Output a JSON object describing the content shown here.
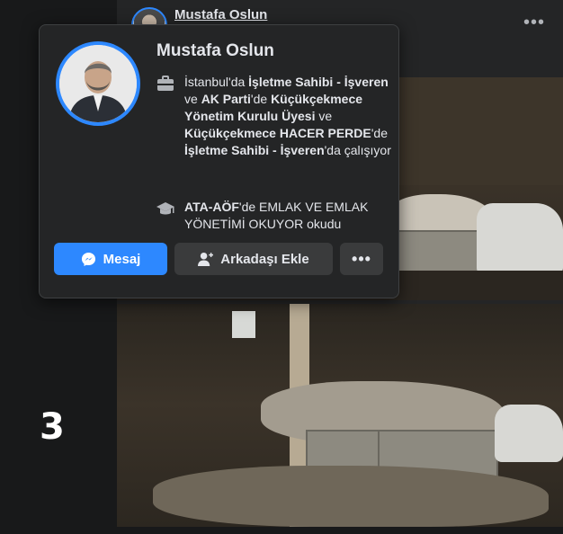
{
  "post": {
    "author_name": "Mustafa Oslun",
    "more_label": "•••"
  },
  "side": {
    "step_number": "3"
  },
  "hover_card": {
    "name": "Mustafa Oslun",
    "work": {
      "p1": "İstanbul'da ",
      "b1": "İşletme Sahibi - İşveren",
      "p2": " ve ",
      "b2": "AK Parti",
      "p3": "'de ",
      "b3": "Küçükçekmece Yönetim Kurulu Üyesi",
      "p4": " ve ",
      "b4": "Küçükçekmece HACER PERDE",
      "p5": "'de ",
      "b5": "İşletme Sahibi - İşveren",
      "p6": "'da çalışıyor"
    },
    "education": {
      "b1": "ATA-AÖF",
      "p1": "'de EMLAK VE EMLAK YÖNETİMİ OKUYOR okudu"
    },
    "buttons": {
      "message": "Mesaj",
      "add_friend": "Arkadaşı Ekle",
      "more": "•••"
    }
  },
  "colors": {
    "primary": "#2d88ff",
    "card_bg": "#242526",
    "page_bg": "#18191a",
    "secondary_button": "#3a3b3c"
  },
  "icons": {
    "work": "briefcase-icon",
    "education": "graduation-cap-icon",
    "message": "messenger-icon",
    "add_friend": "add-friend-icon",
    "more": "more-dots-icon"
  }
}
